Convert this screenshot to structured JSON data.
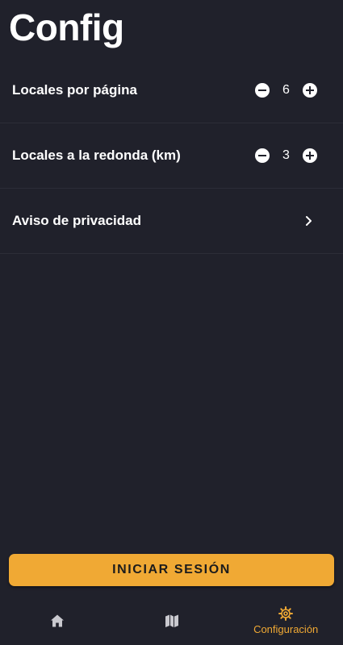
{
  "header": {
    "title": "Config"
  },
  "settings": {
    "locales_por_pagina": {
      "label": "Locales por página",
      "value": "6",
      "decrement_icon": "minus-circle-icon",
      "increment_icon": "plus-circle-icon"
    },
    "locales_redonda": {
      "label": "Locales a la redonda (km)",
      "value": "3",
      "decrement_icon": "minus-circle-icon",
      "increment_icon": "plus-circle-icon"
    },
    "aviso_privacidad": {
      "label": "Aviso de privacidad",
      "icon": "chevron-right-icon"
    }
  },
  "actions": {
    "login_label": "INICIAR SESIÓN"
  },
  "bottom_nav": {
    "items": [
      {
        "icon": "home-icon",
        "label": "",
        "active": false
      },
      {
        "icon": "map-icon",
        "label": "",
        "active": false
      },
      {
        "icon": "gear-icon",
        "label": "Configuración",
        "active": true
      }
    ]
  },
  "colors": {
    "background": "#20212b",
    "accent": "#f0a934",
    "text": "#ffffff",
    "inactive_icon": "#c9c9cf",
    "divider": "#2c2d38"
  }
}
